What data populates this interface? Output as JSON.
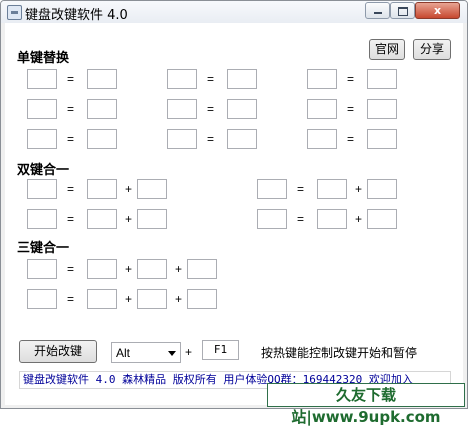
{
  "window": {
    "title": "键盘改键软件 4.0",
    "close_glyph": "x"
  },
  "header_buttons": {
    "official_site": "官网",
    "share": "分享"
  },
  "sections": {
    "single": "单键替换",
    "double": "双键合一",
    "triple": "三键合一"
  },
  "operators": {
    "equals": "=",
    "plus": "+"
  },
  "controls": {
    "start_button": "开始改键",
    "modifier_selected": "Alt",
    "hotkey_value": "F1",
    "hint": "按热键能控制改键开始和暂停"
  },
  "status_text": "键盘改键软件 4.0 森林精品 版权所有 用户体验QQ群：169442320 欢迎加入",
  "watermark": "久友下载站|www.9upk.com",
  "icons": [
    "app-icon",
    "minimize-icon",
    "maximize-icon",
    "close-icon",
    "chevron-down-icon"
  ]
}
